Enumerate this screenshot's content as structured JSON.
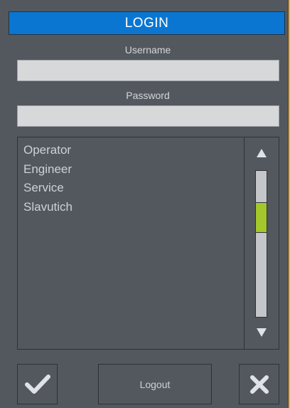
{
  "header": {
    "title": "LOGIN"
  },
  "form": {
    "username_label": "Username",
    "username_value": "",
    "password_label": "Password",
    "password_value": ""
  },
  "user_list": {
    "items": [
      "Operator",
      "Engineer",
      "Service",
      "Slavutich"
    ]
  },
  "scrollbar": {
    "up_icon": "triangle-up-icon",
    "down_icon": "triangle-down-icon",
    "thumb_position_fraction": 0.27,
    "thumb_size_fraction": 0.21
  },
  "actions": {
    "confirm_icon": "checkmark-icon",
    "logout_label": "Logout",
    "cancel_icon": "close-icon"
  },
  "colors": {
    "page_background": "#f2b31c",
    "panel_background": "#53585f",
    "title_bar": "#0a76d2",
    "field_background": "#d7d8d9",
    "scroll_thumb": "#a4c72b",
    "icon_color": "#dfe2e6"
  }
}
